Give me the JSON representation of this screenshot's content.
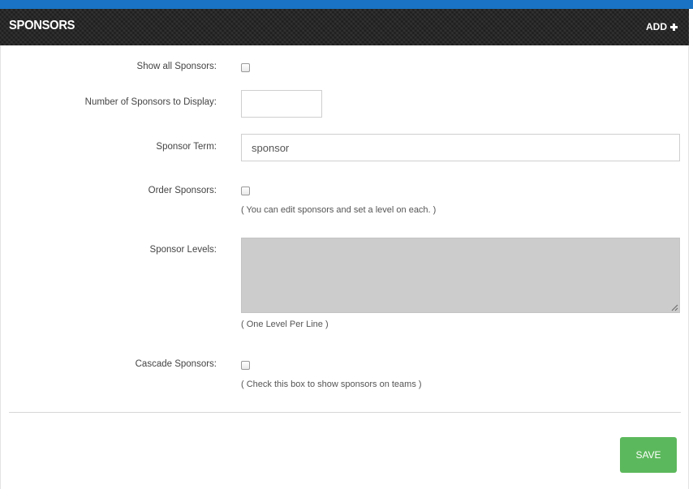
{
  "header": {
    "title": "SPONSORS",
    "add_label": "ADD",
    "add_icon": "plus-icon",
    "top_bar_color": "#1a73c4"
  },
  "form": {
    "show_all": {
      "label": "Show all Sponsors:",
      "checked": false
    },
    "number_to_display": {
      "label": "Number of Sponsors to Display:",
      "value": ""
    },
    "sponsor_term": {
      "label": "Sponsor Term:",
      "value": "sponsor"
    },
    "order_sponsors": {
      "label": "Order Sponsors:",
      "checked": false,
      "hint": "( You can edit sponsors and set a level on each. )"
    },
    "sponsor_levels": {
      "label": "Sponsor Levels:",
      "value": "",
      "hint": "( One Level Per Line )"
    },
    "cascade_sponsors": {
      "label": "Cascade Sponsors:",
      "checked": false,
      "hint": "( Check this box to show sponsors on teams )"
    }
  },
  "actions": {
    "save_label": "SAVE",
    "save_color": "#5cb85c"
  }
}
